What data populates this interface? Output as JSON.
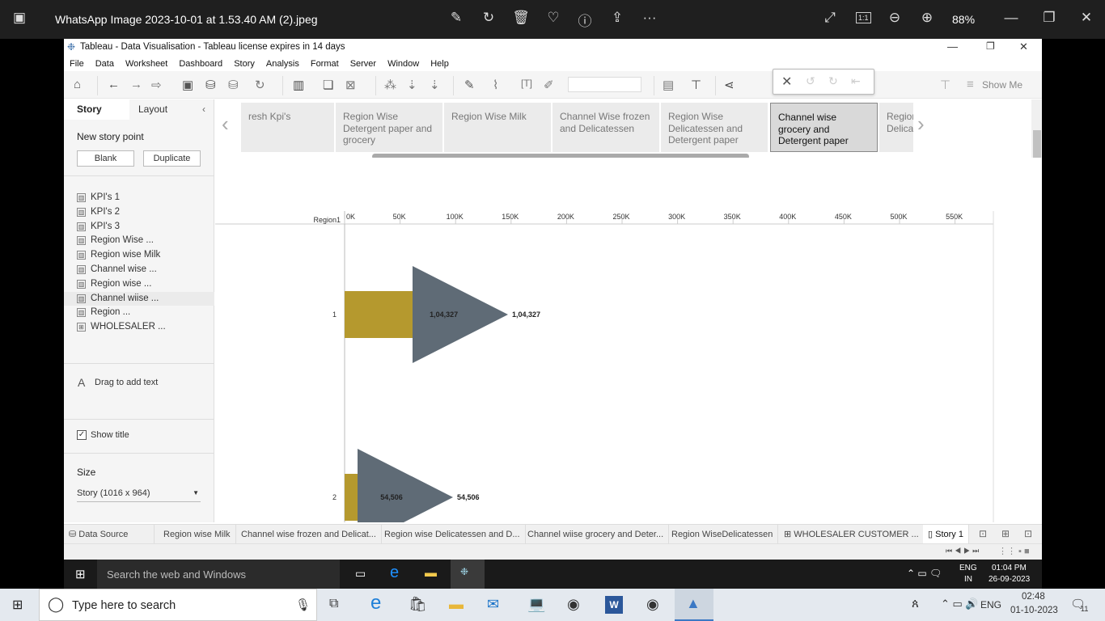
{
  "viewer": {
    "title": "WhatsApp Image 2023-10-01 at 1.53.40 AM (2).jpeg",
    "zoom": "88%",
    "actual_size": "1:1"
  },
  "window": {
    "title": "Tableau - Data Visualisation - Tableau license expires in 14 days"
  },
  "menu": [
    "File",
    "Data",
    "Worksheet",
    "Dashboard",
    "Story",
    "Analysis",
    "Format",
    "Server",
    "Window",
    "Help"
  ],
  "toolbar": {
    "show_me": "Show Me"
  },
  "left": {
    "tab_story": "Story",
    "tab_layout": "Layout",
    "new_story_point": "New story point",
    "blank": "Blank",
    "duplicate": "Duplicate",
    "sheets": [
      "KPI's 1",
      "KPI's 2",
      "KPI's 3",
      "Region Wise ...",
      "Region wise Milk",
      "Channel wise ...",
      "Region wise ...",
      "Channel wiise ...",
      "Region ...",
      "WHOLESALER ..."
    ],
    "drag_text": "Drag to add text",
    "show_title": "Show title",
    "size_label": "Size",
    "size_value": "Story (1016 x 964)"
  },
  "story_points": [
    "resh Kpi's",
    "Region Wise Detergent paper and grocery",
    "Region Wise Milk",
    "Channel Wise frozen and Delicatessen",
    "Region Wise Delicatessen and Detergent paper",
    "Channel wise grocery and Detergent paper",
    "Region Delicat"
  ],
  "chart_data": {
    "type": "bar",
    "row_header": "Region1",
    "categories": [
      "1",
      "2"
    ],
    "values": [
      104327,
      54506
    ],
    "labels": [
      "1,04,327",
      "54,506"
    ],
    "xticks": [
      "0K",
      "50K",
      "100K",
      "150K",
      "200K",
      "250K",
      "300K",
      "350K",
      "400K",
      "450K",
      "500K",
      "550K"
    ],
    "xlim": [
      0,
      580000
    ],
    "colors": {
      "bar": "#b5992e",
      "marker": "#5f6b76"
    }
  },
  "bottom_tabs": [
    "Data Source",
    "Region wise Milk",
    "Channel wise frozen and Delicat...",
    "Region wise Delicatessen and D...",
    "Channel wiise grocery and Deter...",
    "Region WiseDelicatessen",
    "WHOLESALER CUSTOMER ...",
    "Story 1"
  ],
  "inner_taskbar": {
    "search": "Search the web and Windows",
    "lang1": "ENG",
    "lang2": "IN",
    "time": "01:04 PM",
    "date": "26-09-2023"
  },
  "outer_taskbar": {
    "search": "Type here to search",
    "lang": "ENG",
    "time": "02:48",
    "date": "01-10-2023",
    "notif": "11"
  }
}
